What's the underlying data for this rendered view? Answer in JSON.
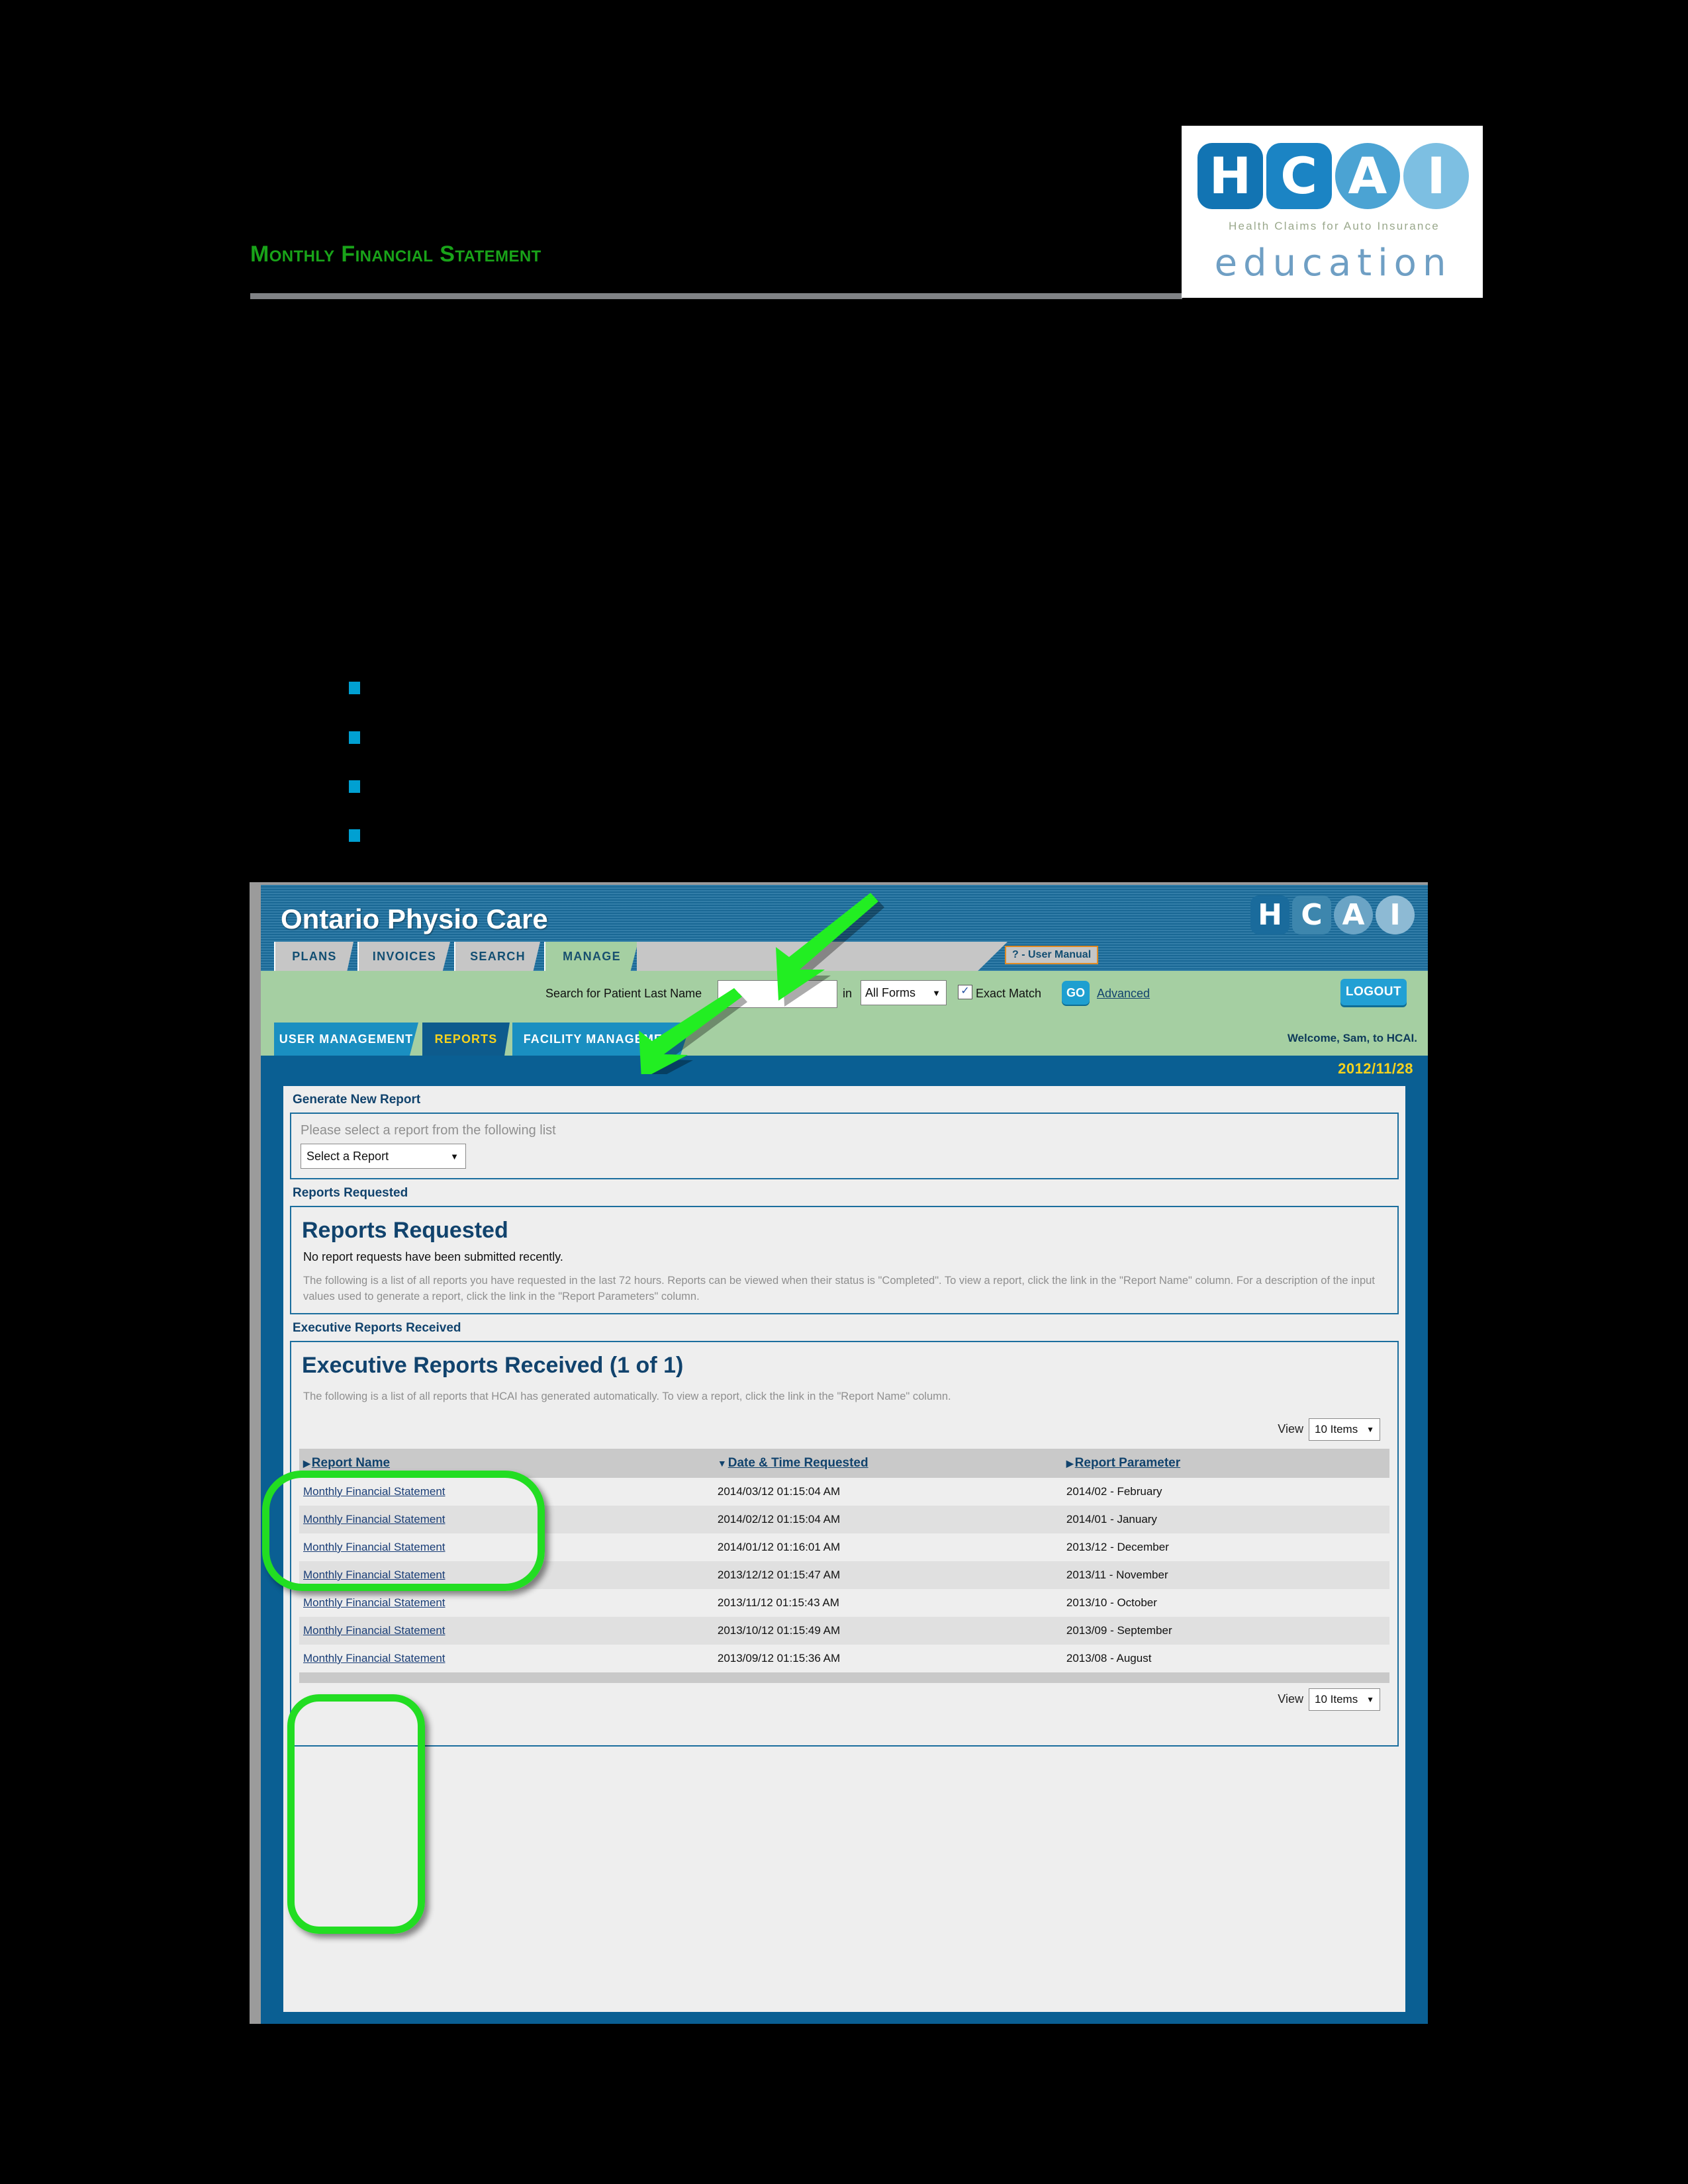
{
  "document": {
    "title": "Monthly Financial Statement",
    "logo": {
      "letters": [
        "H",
        "C",
        "A",
        "I"
      ],
      "tagline": "Health Claims for Auto Insurance",
      "wordmark": "education"
    },
    "bullets": [
      "",
      "",
      "",
      ""
    ]
  },
  "screenshot": {
    "header": {
      "app_name": "Ontario Physio Care",
      "user_manual_label": "? - User Manual",
      "logo_letters": [
        "H",
        "C",
        "A",
        "I"
      ],
      "tabs": [
        {
          "label": "PLANS",
          "active": false
        },
        {
          "label": "INVOICES",
          "active": false
        },
        {
          "label": "SEARCH",
          "active": false
        },
        {
          "label": "MANAGE",
          "active": true
        }
      ]
    },
    "search": {
      "label": "Search for Patient Last Name",
      "value": "",
      "placeholder": "",
      "in_label": "in",
      "forms_selected": "All Forms",
      "exact_match_label": "Exact Match",
      "exact_match_checked": "✓",
      "go_label": "GO",
      "advanced_label": "Advanced",
      "logout_label": "LOGOUT"
    },
    "subtabs": [
      {
        "label": "USER MANAGEMENT",
        "active": false
      },
      {
        "label": "REPORTS",
        "active": true
      },
      {
        "label": "FACILITY MANAGEMENT",
        "active": false
      }
    ],
    "welcome": "Welcome, Sam, to HCAI.",
    "date": "2012/11/28",
    "generate": {
      "section_label": "Generate New Report",
      "instruction": "Please select a report from the following list",
      "select_value": "Select a Report"
    },
    "requested": {
      "section_label": "Reports Requested",
      "heading": "Reports Requested",
      "empty_message": "No report requests have been submitted recently.",
      "description": "The following is a list of all reports you have requested in the last 72 hours. Reports can be viewed when their status is \"Completed\". To view a report, click the link in the \"Report Name\" column. For a description of the input values used to generate a report, click the link in the \"Report Parameters\" column."
    },
    "executive": {
      "section_label": "Executive Reports Received",
      "heading": "Executive Reports Received (1 of 1)",
      "description": "The following is a list of all reports that HCAI has generated automatically. To view a report, click the link in the \"Report Name\" column.",
      "view_label": "View",
      "view_value": "10 Items",
      "columns": [
        {
          "label": "Report Name",
          "sort": "▶"
        },
        {
          "label": "Date & Time Requested",
          "sort": "▼"
        },
        {
          "label": "Report Parameter",
          "sort": "▶"
        }
      ],
      "rows": [
        {
          "name": "Monthly Financial Statement",
          "datetime": "2014/03/12 01:15:04 AM",
          "parameter": "2014/02 - February"
        },
        {
          "name": "Monthly Financial Statement",
          "datetime": "2014/02/12 01:15:04 AM",
          "parameter": "2014/01 - January"
        },
        {
          "name": "Monthly Financial Statement",
          "datetime": "2014/01/12 01:16:01 AM",
          "parameter": "2013/12 - December"
        },
        {
          "name": "Monthly Financial Statement",
          "datetime": "2013/12/12 01:15:47 AM",
          "parameter": "2013/11 - November"
        },
        {
          "name": "Monthly Financial Statement",
          "datetime": "2013/11/12 01:15:43 AM",
          "parameter": "2013/10 - October"
        },
        {
          "name": "Monthly Financial Statement",
          "datetime": "2013/10/12 01:15:49 AM",
          "parameter": "2013/09 - September"
        },
        {
          "name": "Monthly Financial Statement",
          "datetime": "2013/09/12 01:15:36 AM",
          "parameter": "2013/08 - August"
        }
      ],
      "footer_view_label": "View",
      "footer_view_value": "10 Items"
    }
  },
  "colors": {
    "annotation_green": "#22dd22",
    "title_green": "#19a319",
    "header_blue": "#1b6e9e",
    "band_green": "#a5cfa2",
    "body_blue": "#0a5f93",
    "accent_yellow": "#f6d21e",
    "bullet_blue": "#00a0d2"
  }
}
